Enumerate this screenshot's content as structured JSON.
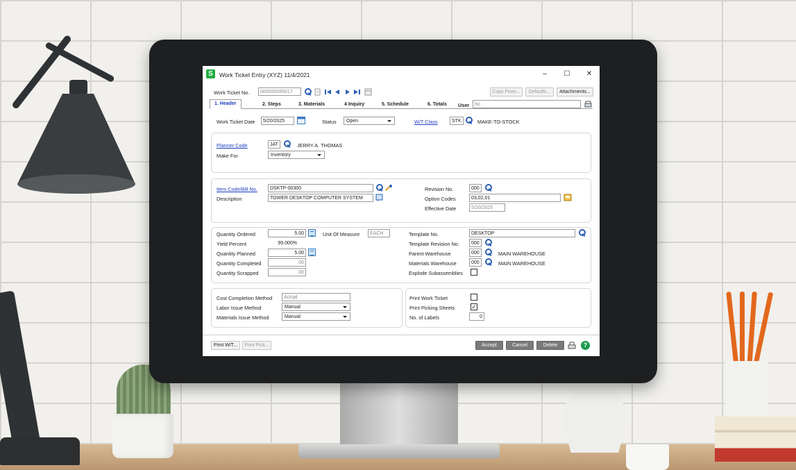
{
  "window": {
    "app_icon_letter": "S",
    "title": "Work Ticket Entry (XYZ) 11/4/2021",
    "minimize": "–",
    "maximize": "☐",
    "close": "✕"
  },
  "toolbar": {
    "ticket_label": "Work Ticket No.",
    "ticket_value": "000000095017",
    "copy_from": "Copy From...",
    "defaults": "Defaults...",
    "attachments": "Attachments..."
  },
  "tabs": [
    {
      "label": "1. Header"
    },
    {
      "label": "2. Steps"
    },
    {
      "label": "3. Materials"
    },
    {
      "label": "4 Inquiry"
    },
    {
      "label": "5. Schedule"
    },
    {
      "label": "6. Totals"
    }
  ],
  "user": {
    "label": "User",
    "value": "lsc"
  },
  "header": {
    "date_label": "Work Ticket Date",
    "date_value": "5/20/2025",
    "status_label": "Status",
    "status_value": "Open",
    "wt_class_label": "W/T Class",
    "wt_class_value": "STK",
    "wt_class_desc": "MAKE-TO-STOCK"
  },
  "planner": {
    "planner_code_label": "Planner Code",
    "planner_code_value": "JAT",
    "planner_name": "JERRY A. THOMAS",
    "make_for_label": "Make For",
    "make_for_value": "Inventory"
  },
  "item": {
    "item_code_label": "Item Code/Bill No.",
    "item_code_value": "DSKTP-00300",
    "description_label": "Description",
    "description_value": "TOWER DESKTOP COMPUTER SYSTEM",
    "revision_label": "Revision No.",
    "revision_value": "000",
    "option_codes_label": "Option Codes",
    "option_codes_value": "03,02,01",
    "effective_date_label": "Effective Date",
    "effective_date_value": "5/20/2025"
  },
  "quantities": {
    "ordered_label": "Quantity Ordered",
    "ordered_value": "5.00",
    "uom_label": "Unit Of Measure",
    "uom_value": "EACH",
    "yield_label": "Yield Percent",
    "yield_value": "99.000%",
    "planned_label": "Quantity Planned",
    "planned_value": "5.00",
    "completed_label": "Quantity Completed",
    "completed_value": ".00",
    "scrapped_label": "Quantity Scrapped",
    "scrapped_value": ".00",
    "template_label": "Template No.",
    "template_value": "DESKTOP",
    "template_rev_label": "Template Revision No.",
    "template_rev_value": "000",
    "parent_wh_label": "Parent Warehouse",
    "parent_wh_value": "000",
    "parent_wh_desc": "MAIN WAREHOUSE",
    "materials_wh_label": "Materials Warehouse",
    "materials_wh_value": "000",
    "materials_wh_desc": "MAIN WAREHOUSE",
    "explode_label": "Explode Subassemblies"
  },
  "methods": {
    "cost_label": "Cost Completion Method",
    "cost_value": "Actual",
    "labor_label": "Labor Issue Method",
    "labor_value": "Manual",
    "materials_label": "Materials Issue Method",
    "materials_value": "Manual",
    "print_ticket_label": "Print Work Ticket",
    "print_picking_label": "Print Picking Sheets",
    "print_picking_mark": "✓",
    "labels_label": "No. of Labels",
    "labels_value": "0"
  },
  "footer": {
    "print_wt": "Print W/T...",
    "print_pick": "Print Pick...",
    "accept": "Accept",
    "cancel": "Cancel",
    "delete": "Delete",
    "help": "?"
  },
  "colors": {
    "link": "#1d3fbf",
    "app_icon": "#1fae3d",
    "monitor_bezel": "#1d1f21"
  }
}
